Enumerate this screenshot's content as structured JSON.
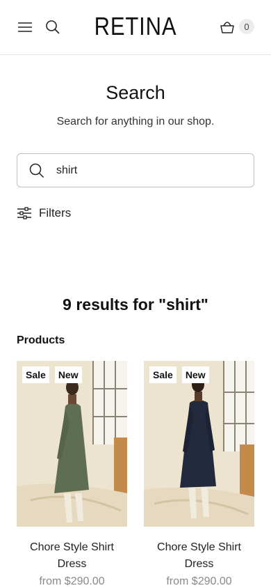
{
  "header": {
    "logo": "RETINA",
    "cart_count": "0",
    "icons": [
      "menu-icon",
      "search-icon",
      "cart-icon"
    ]
  },
  "search_page": {
    "title": "Search",
    "subtitle": "Search for anything in our shop.",
    "query": "shirt",
    "filters_label": "Filters",
    "results_title": "9 results for \"shirt\"",
    "section_label": "Products"
  },
  "products": [
    {
      "badges": [
        "Sale",
        "New"
      ],
      "name": "Chore Style Shirt Dress",
      "price": "from $290.00",
      "dress_color": "#5f6e52"
    },
    {
      "badges": [
        "Sale",
        "New"
      ],
      "name": "Chore Style Shirt Dress",
      "price": "from $290.00",
      "dress_color": "#242a3d"
    }
  ]
}
